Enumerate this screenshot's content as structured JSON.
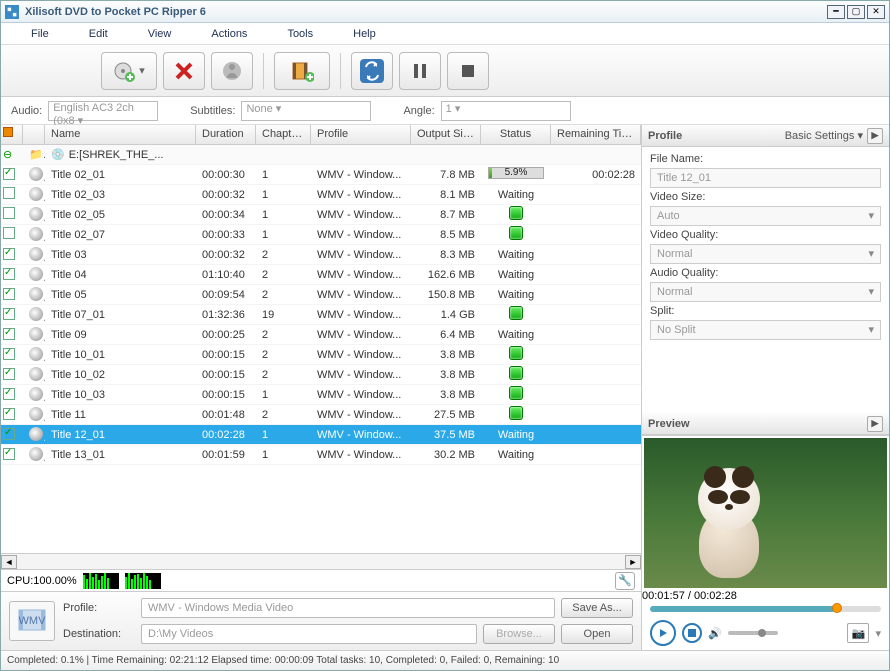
{
  "app": {
    "title": "Xilisoft DVD to Pocket PC Ripper 6"
  },
  "menu": {
    "file": "File",
    "edit": "Edit",
    "view": "View",
    "actions": "Actions",
    "tools": "Tools",
    "help": "Help"
  },
  "filter": {
    "audio_label": "Audio:",
    "audio_value": "English AC3 2ch (0x8",
    "subtitles_label": "Subtitles:",
    "subtitles_value": "None",
    "angle_label": "Angle:",
    "angle_value": "1"
  },
  "columns": {
    "name": "Name",
    "duration": "Duration",
    "chapters": "Chapters",
    "profile": "Profile",
    "output": "Output Size",
    "status": "Status",
    "remaining": "Remaining Time"
  },
  "root": {
    "name": "E:[SHREK_THE_..."
  },
  "rows": [
    {
      "chk": true,
      "name": "Title 02_01",
      "dur": "00:00:30",
      "chap": "1",
      "prof": "WMV - Window...",
      "out": "7.8 MB",
      "status": "progress",
      "progress": 5.9,
      "rem": "00:02:28"
    },
    {
      "chk": false,
      "name": "Title 02_03",
      "dur": "00:00:32",
      "chap": "1",
      "prof": "WMV - Window...",
      "out": "8.1 MB",
      "status": "Waiting"
    },
    {
      "chk": false,
      "name": "Title 02_05",
      "dur": "00:00:34",
      "chap": "1",
      "prof": "WMV - Window...",
      "out": "8.7 MB",
      "status": "green"
    },
    {
      "chk": false,
      "name": "Title 02_07",
      "dur": "00:00:33",
      "chap": "1",
      "prof": "WMV - Window...",
      "out": "8.5 MB",
      "status": "green"
    },
    {
      "chk": true,
      "name": "Title 03",
      "dur": "00:00:32",
      "chap": "2",
      "prof": "WMV - Window...",
      "out": "8.3 MB",
      "status": "Waiting"
    },
    {
      "chk": true,
      "name": "Title 04",
      "dur": "01:10:40",
      "chap": "2",
      "prof": "WMV - Window...",
      "out": "162.6 MB",
      "status": "Waiting"
    },
    {
      "chk": true,
      "name": "Title 05",
      "dur": "00:09:54",
      "chap": "2",
      "prof": "WMV - Window...",
      "out": "150.8 MB",
      "status": "Waiting"
    },
    {
      "chk": true,
      "name": "Title 07_01",
      "dur": "01:32:36",
      "chap": "19",
      "prof": "WMV - Window...",
      "out": "1.4 GB",
      "status": "green"
    },
    {
      "chk": true,
      "name": "Title 09",
      "dur": "00:00:25",
      "chap": "2",
      "prof": "WMV - Window...",
      "out": "6.4 MB",
      "status": "Waiting"
    },
    {
      "chk": true,
      "name": "Title 10_01",
      "dur": "00:00:15",
      "chap": "2",
      "prof": "WMV - Window...",
      "out": "3.8 MB",
      "status": "green"
    },
    {
      "chk": true,
      "name": "Title 10_02",
      "dur": "00:00:15",
      "chap": "2",
      "prof": "WMV - Window...",
      "out": "3.8 MB",
      "status": "green"
    },
    {
      "chk": true,
      "name": "Title 10_03",
      "dur": "00:00:15",
      "chap": "1",
      "prof": "WMV - Window...",
      "out": "3.8 MB",
      "status": "green"
    },
    {
      "chk": true,
      "name": "Title 11",
      "dur": "00:01:48",
      "chap": "2",
      "prof": "WMV - Window...",
      "out": "27.5 MB",
      "status": "green"
    },
    {
      "chk": true,
      "sel": true,
      "name": "Title 12_01",
      "dur": "00:02:28",
      "chap": "1",
      "prof": "WMV - Window...",
      "out": "37.5 MB",
      "status": "Waiting"
    },
    {
      "chk": true,
      "name": "Title 13_01",
      "dur": "00:01:59",
      "chap": "1",
      "prof": "WMV - Window...",
      "out": "30.2 MB",
      "status": "Waiting"
    }
  ],
  "cpu": {
    "label": "CPU:100.00%"
  },
  "bottom": {
    "profile_label": "Profile:",
    "profile_value": "WMV - Windows Media Video",
    "dest_label": "Destination:",
    "dest_value": "D:\\My Videos",
    "saveas": "Save As...",
    "browse": "Browse...",
    "open": "Open"
  },
  "profile_panel": {
    "title": "Profile",
    "settings": "Basic Settings",
    "filename_label": "File Name:",
    "filename": "Title 12_01",
    "videosize_label": "Video Size:",
    "videosize": "Auto",
    "videoqual_label": "Video Quality:",
    "videoqual": "Normal",
    "audioqual_label": "Audio Quality:",
    "audioqual": "Normal",
    "split_label": "Split:",
    "split": "No Split"
  },
  "preview": {
    "title": "Preview",
    "time": "00:01:57 / 00:02:28"
  },
  "status": "Completed: 0.1% | Time Remaining: 02:21:12 Elapsed time: 00:00:09 Total tasks: 10, Completed: 0, Failed: 0, Remaining: 10"
}
